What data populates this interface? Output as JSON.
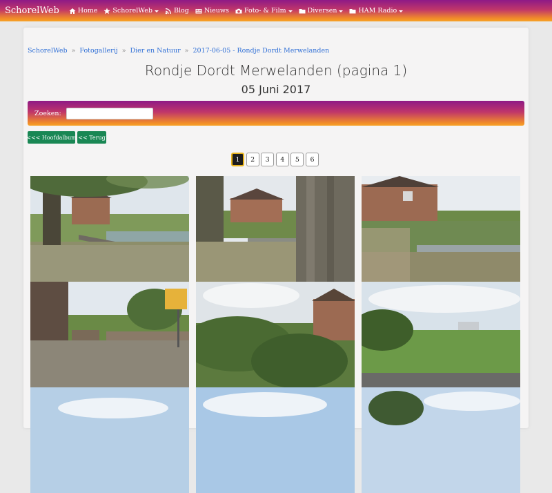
{
  "nav": {
    "brand": "SchorelWeb",
    "items": [
      {
        "label": "Home",
        "icon": "home-icon",
        "dropdown": false
      },
      {
        "label": "SchorelWeb",
        "icon": "star-icon",
        "dropdown": true
      },
      {
        "label": "Blog",
        "icon": "rss-icon",
        "dropdown": false
      },
      {
        "label": "Nieuws",
        "icon": "newspaper-icon",
        "dropdown": false
      },
      {
        "label": "Foto- & Film",
        "icon": "camera-icon",
        "dropdown": true
      },
      {
        "label": "Diversen",
        "icon": "folder-icon",
        "dropdown": true
      },
      {
        "label": "HAM Radio",
        "icon": "folder-icon",
        "dropdown": true
      }
    ]
  },
  "breadcrumb": [
    "SchorelWeb",
    "Fotogallerij",
    "Dier en Natuur",
    "2017-06-05 - Rondje Dordt Merwelanden"
  ],
  "page": {
    "title": "Rondje Dordt Merwelanden (pagina 1)",
    "subtitle": "05 Juni 2017"
  },
  "search": {
    "label": "Zoeken:",
    "value": ""
  },
  "buttons": {
    "main_album": "<<< Hoofdalbum",
    "back": "<< Terug"
  },
  "pagination": {
    "pages": [
      "1",
      "2",
      "3",
      "4",
      "5",
      "6"
    ],
    "current": "1"
  },
  "gallery": {
    "photos": [
      {
        "subject": "canal-with-house-and-willow"
      },
      {
        "subject": "house-behind-tree-trunk"
      },
      {
        "subject": "brick-house-with-jetty"
      },
      {
        "subject": "path-with-shed-and-sign"
      },
      {
        "subject": "house-behind-bushes"
      },
      {
        "subject": "meadow-with-buildings"
      },
      {
        "subject": "sky"
      },
      {
        "subject": "sky"
      },
      {
        "subject": "sky-with-trees"
      }
    ]
  },
  "colors": {
    "accent_start": "#8e1a86",
    "accent_end": "#f7a326",
    "link": "#2f6fd6",
    "button_green": "#198754"
  }
}
